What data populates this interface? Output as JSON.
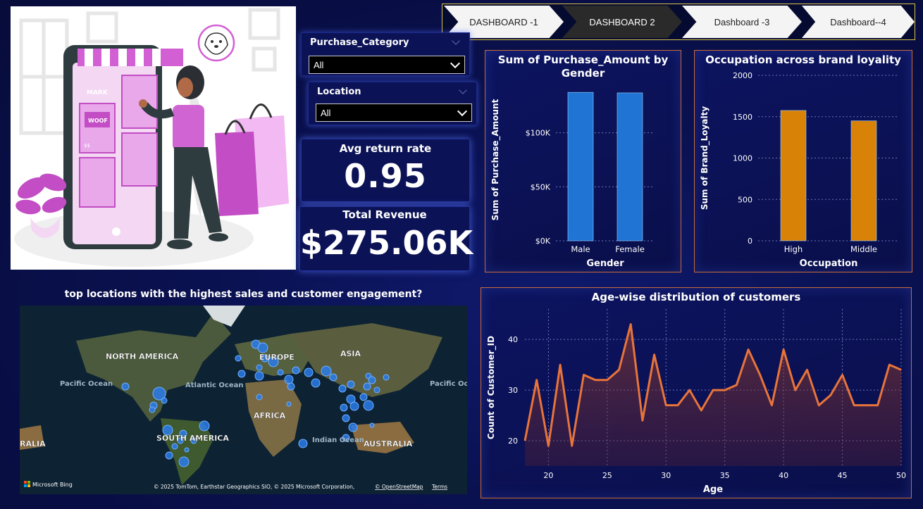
{
  "nav": {
    "tabs": [
      {
        "label": "DASHBOARD -1",
        "active": false
      },
      {
        "label": "DASHBOARD 2",
        "active": true
      },
      {
        "label": "Dashboard -3",
        "active": false
      },
      {
        "label": "Dashboard--4",
        "active": false
      }
    ]
  },
  "illustration": {
    "store_sign": "MARK",
    "card_text": "WOOF",
    "price_label": "$$"
  },
  "slicers": {
    "purchase_category": {
      "title": "Purchase_Category",
      "value": "All"
    },
    "location": {
      "title": "Location",
      "value": "All"
    }
  },
  "kpis": {
    "avg_return": {
      "title": "Avg return rate",
      "value": "0.95"
    },
    "total_revenue": {
      "title": "Total Revenue",
      "value": "$275.06K"
    }
  },
  "map": {
    "title": "top locations with the highest sales and customer engagement?",
    "labels": {
      "north_america": "NORTH AMERICA",
      "europe": "EUROPE",
      "asia": "ASIA",
      "africa": "AFRICA",
      "south_america": "SOUTH AMERICA",
      "australia": "AUSTRALIA",
      "pacific_left": "Pacific Ocean",
      "atlantic": "Atlantic Ocean",
      "indian": "Indian Ocean",
      "pacific_right": "Pacific Ocean",
      "ralia": "RALIA"
    },
    "brand": "Microsoft Bing",
    "attribution": "© 2025 TomTom, Earthstar Geographics SIO, © 2025 Microsoft Corporation,",
    "osm_link": "© OpenStreetMap",
    "terms": "Terms"
  },
  "chart_data": [
    {
      "type": "bar",
      "title": "Sum of Purchase_Amount by Gender",
      "xlabel": "Gender",
      "ylabel": "Sum of Purchase_Amount",
      "categories": [
        "Male",
        "Female"
      ],
      "values": [
        137500,
        137000
      ],
      "ylim": [
        0,
        150000
      ],
      "yticks": [
        0,
        50000,
        100000
      ],
      "ytick_labels": [
        "$0K",
        "$50K",
        "$100K"
      ],
      "grid": true,
      "color": "#1f74d4"
    },
    {
      "type": "bar",
      "title": "Occupation across brand loyality",
      "xlabel": "Occupation",
      "ylabel": "Sum of Brand_Loyalty",
      "categories": [
        "High",
        "Middle"
      ],
      "values": [
        1575,
        1450
      ],
      "ylim": [
        0,
        2000
      ],
      "yticks": [
        0,
        500,
        1000,
        1500,
        2000
      ],
      "ytick_labels": [
        "0",
        "500",
        "1000",
        "1500",
        "2000"
      ],
      "grid": true,
      "color": "#d98208"
    },
    {
      "type": "area",
      "title": "Age-wise distribution of customers",
      "xlabel": "Age",
      "ylabel": "Count of Customer_ID",
      "x": [
        18,
        19,
        20,
        21,
        22,
        23,
        24,
        25,
        26,
        27,
        28,
        29,
        30,
        31,
        32,
        33,
        34,
        35,
        36,
        37,
        38,
        39,
        40,
        41,
        42,
        43,
        44,
        45,
        46,
        47,
        48,
        49,
        50
      ],
      "y": [
        20,
        32,
        19,
        35,
        19,
        33,
        32,
        32,
        34,
        43,
        24,
        37,
        27,
        27,
        30,
        26,
        30,
        30,
        31,
        38,
        33,
        27,
        38,
        30,
        34,
        27,
        29,
        33,
        27,
        27,
        27,
        35,
        34
      ],
      "xlim": [
        18,
        50
      ],
      "ylim": [
        15,
        46
      ],
      "xticks": [
        20,
        25,
        30,
        35,
        40,
        45,
        50
      ],
      "yticks": [
        20,
        30,
        40
      ],
      "grid": true,
      "color": "#e8743b"
    }
  ]
}
